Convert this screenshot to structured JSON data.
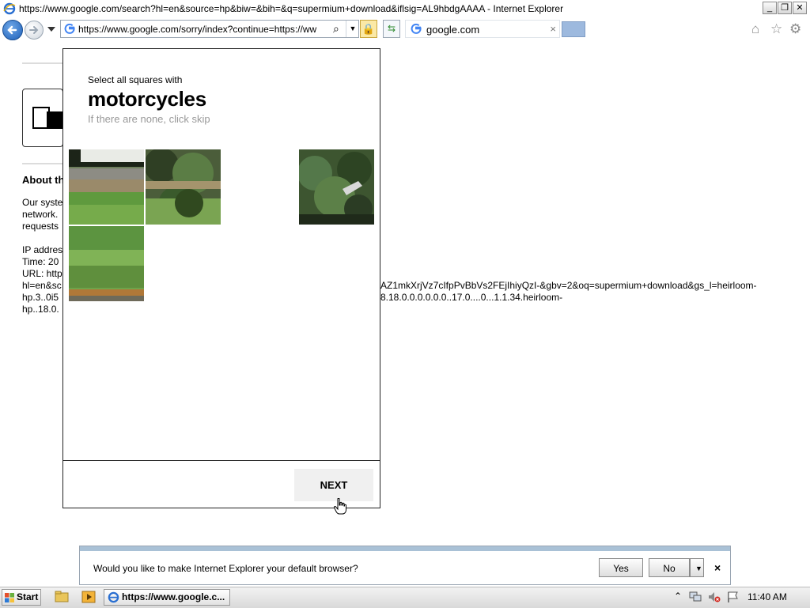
{
  "window": {
    "title": "https://www.google.com/search?hl=en&source=hp&biw=&bih=&q=supermium+download&iflsig=AL9hbdgAAAA - Internet Explorer",
    "minimize": "_",
    "restore": "❐",
    "close": "✕"
  },
  "navbar": {
    "address": "https://www.google.com/sorry/index?continue=https://ww",
    "search_glyph": "⌕",
    "dropdown_glyph": "▼",
    "lock_glyph": "🔒",
    "refresh_glyph": "⇆",
    "tab_label": "google.com",
    "tab_close": "×",
    "home_glyph": "⌂",
    "favorites_glyph": "☆",
    "tools_glyph": "⚙"
  },
  "page": {
    "heading": "About th",
    "para1_line1": "Our syste",
    "para1_line2": "network.",
    "para1_line3": "requests",
    "ip_line": "IP addres",
    "time_line": "Time: 20",
    "url_line": "URL: http",
    "url_line2": "hl=en&sc",
    "url_line2_right": "AZ1mkXrjVz7cIfpPvBbVs2FEjIhiyQzI-&gbv=2&oq=supermium+download&gs_l=heirloom-",
    "url_line3": "hp.3..0i5",
    "url_line3_right": "8.18.0.0.0.0.0.0..17.0....0...1.1.34.heirloom-",
    "url_line4": "hp..18.0."
  },
  "captcha": {
    "instruction": "Select all squares with",
    "target_word": "motorcycles",
    "hint": "If there are none, click skip",
    "next_label": "NEXT"
  },
  "infobar": {
    "message": "Would you like to make Internet Explorer your default browser?",
    "yes": "Yes",
    "no": "No",
    "dropdown": "▼",
    "close": "×"
  },
  "taskbar": {
    "start": "Start",
    "active_task": "https://www.google.c...",
    "tray_arrow": "⌃",
    "clock": "11:40 AM"
  },
  "colors": {
    "ie_blue": "#1d5fb8",
    "infobar_strip": "#a9c1d6",
    "tab_new": "#9db9de",
    "hint_gray": "#999999"
  }
}
